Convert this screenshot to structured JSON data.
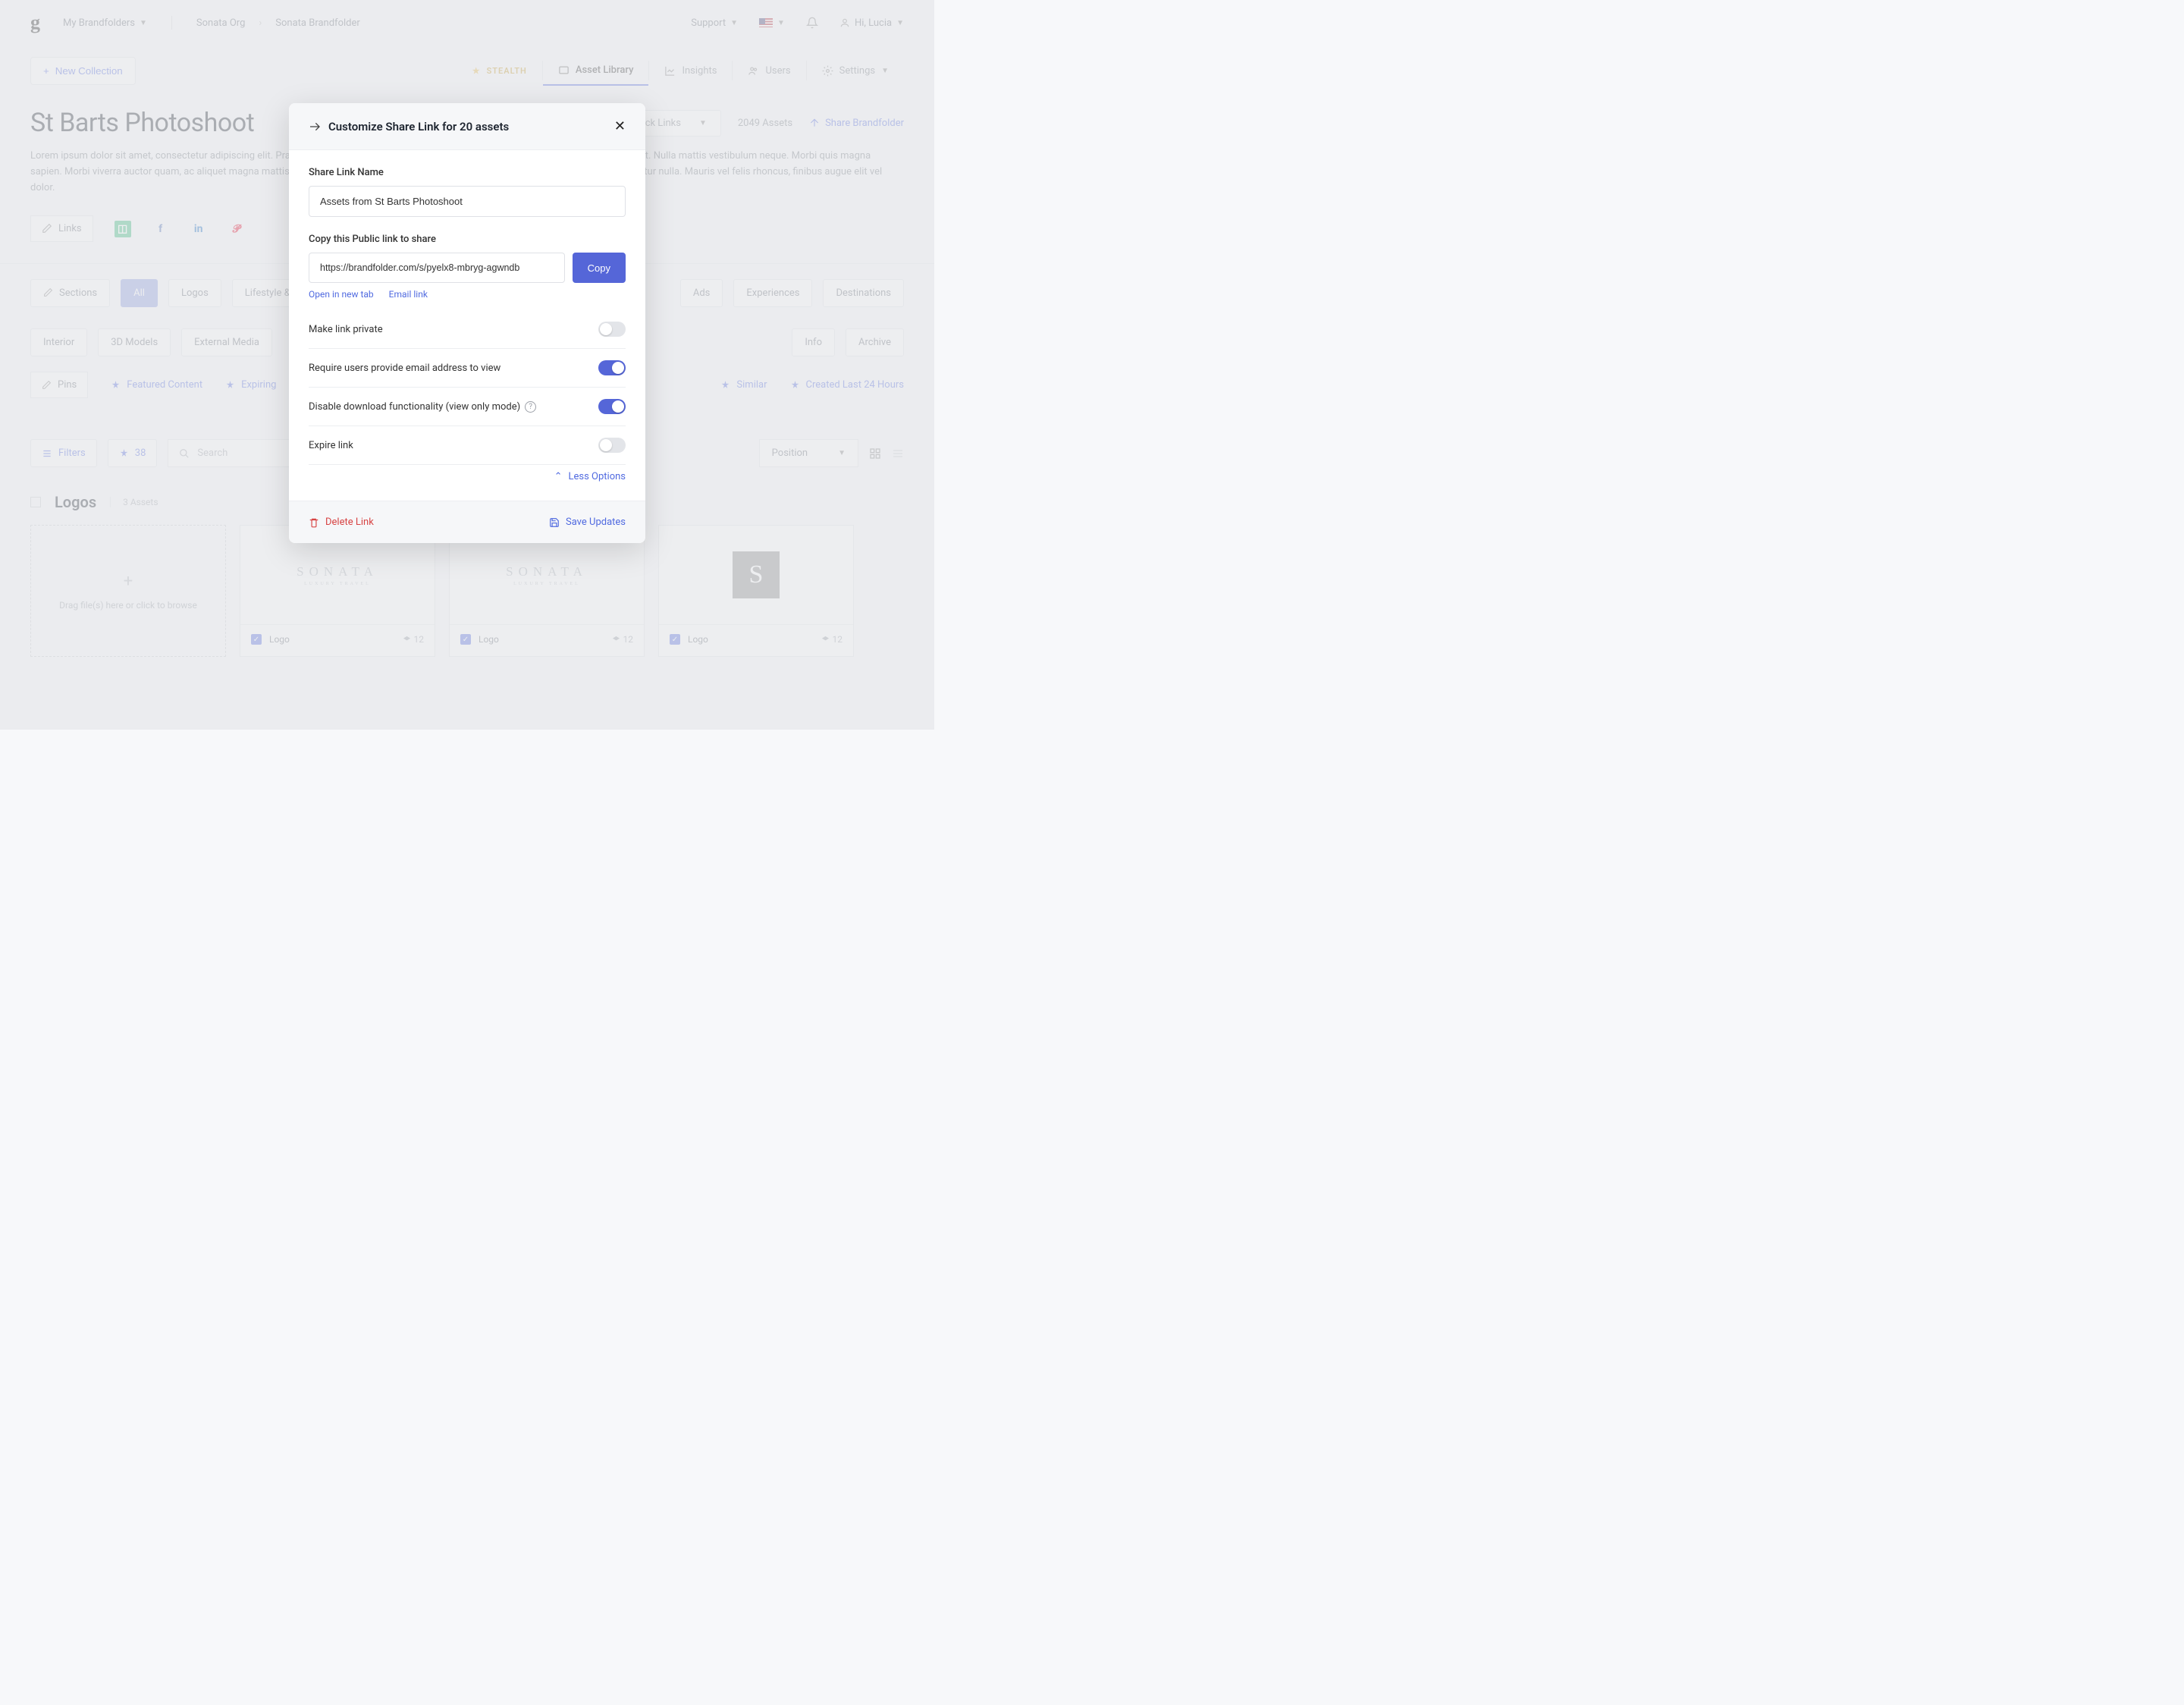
{
  "header": {
    "logo": "g",
    "my_brandfolders": "My Brandfolders",
    "breadcrumb": [
      "Sonata Org",
      "Sonata Brandfolder"
    ],
    "support": "Support",
    "greeting": "Hi, Lucia"
  },
  "nav": {
    "new_collection": "New Collection",
    "stealth": "STEALTH",
    "asset_library": "Asset Library",
    "insights": "Insights",
    "users": "Users",
    "settings": "Settings"
  },
  "page": {
    "title": "St Barts Photoshoot",
    "quick_links": "Quick Links",
    "asset_total": "2049 Assets",
    "share_bf": "Share Brandfolder",
    "desc": "Lorem ipsum dolor sit amet, consectetur adipiscing elit. Praesent semper urna nec felis accumsan interdum. In hac habitasse platea dictumst. Nulla mattis vestibulum neque. Morbi quis magna sapien. Morbi viverra auctor quam, ac aliquet magna mattis nec. Praesent et sagittis metus. Aenean in metus mauris. Quisque eget consectetur nulla. Mauris vel felis rhoncus, finibus augue elit vel dolor.",
    "links_label": "Links"
  },
  "sections": {
    "edit": "Sections",
    "items": [
      "All",
      "Logos",
      "Lifestyle & Loc",
      "",
      "",
      "",
      "",
      "Ads",
      "Experiences",
      "Destinations",
      "Interior",
      "3D Models",
      "External Media",
      "",
      "",
      "",
      "",
      "Info",
      "Archive"
    ]
  },
  "pins": {
    "edit": "Pins",
    "items": [
      "Featured Content",
      "Expiring",
      "",
      "",
      "",
      "Similar",
      "Created Last 24 Hours"
    ]
  },
  "toolbar": {
    "filters": "Filters",
    "pin_count": "38",
    "search_ph": "Search",
    "position": "Position"
  },
  "logos_section": {
    "title": "Logos",
    "count": "3 Assets",
    "dropzone": "Drag file(s) here or click to browse",
    "card_label": "Logo",
    "card_count": "12"
  },
  "modal": {
    "title": "Customize Share Link for 20 assets",
    "name_label": "Share Link Name",
    "name_value": "Assets from St Barts Photoshoot",
    "copy_label": "Copy this Public link to share",
    "link_value": "https://brandfolder.com/s/pyelx8-mbryg-agwndb",
    "copy_btn": "Copy",
    "open_tab": "Open in new tab",
    "email_link": "Email link",
    "opts": {
      "private": "Make link private",
      "email_req": "Require users provide email address to view",
      "disable_dl": "Disable download functionality (view only mode)",
      "expire": "Expire link"
    },
    "less": "Less Options",
    "delete": "Delete Link",
    "save": "Save Updates"
  }
}
